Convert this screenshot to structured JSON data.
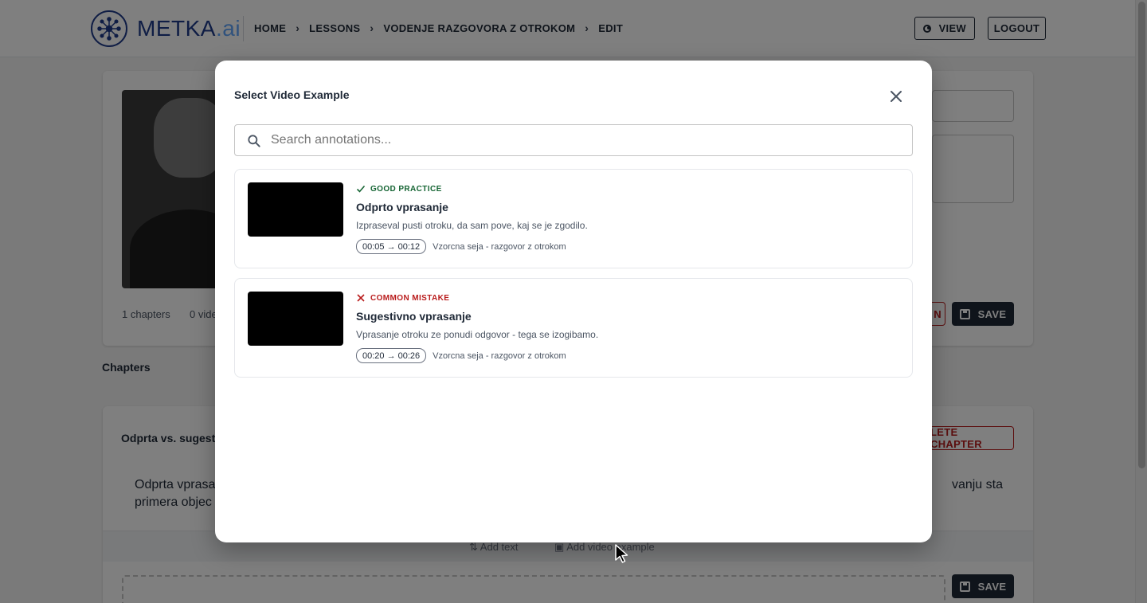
{
  "header": {
    "logo_main": "METKA",
    "logo_suffix": ".ai",
    "breadcrumb": [
      "HOME",
      "LESSONS",
      "VODENJE RAZGOVORA Z OTROKOM",
      "EDIT"
    ],
    "view_label": "VIEW",
    "logout_label": "LOGOUT"
  },
  "background": {
    "chapters_count": "1 chapters",
    "videos_count": "0 vide",
    "delete_partial": "N",
    "save_label": "SAVE",
    "section_label": "Chapters",
    "chapter_title": "Odprta vs. sugesti",
    "chapter_text_line1_left": "Odprta vprasa",
    "chapter_text_line1_right": "vanju sta",
    "chapter_text_line2_left": "primera objec",
    "delete_chapter_label": "LETE CHAPTER",
    "add_text_label": "Add text",
    "add_video_label": "Add video example",
    "save_label_2": "SAVE"
  },
  "modal": {
    "title": "Select Video Example",
    "search_placeholder": "Search annotations...",
    "items": [
      {
        "badge": "GOOD PRACTICE",
        "badge_icon": "check-icon",
        "title": "Odprto vprasanje",
        "description": "Izpraseval pusti otroku, da sam pove, kaj se je zgodilo.",
        "time": "00:05 → 00:12",
        "session": "Vzorcna seja - razgovor z otrokom"
      },
      {
        "badge": "COMMON MISTAKE",
        "badge_icon": "x-icon",
        "title": "Sugestivno vprasanje",
        "description": "Vprasanje otroku ze ponudi odgovor - tega se izogibamo.",
        "time": "00:20 → 00:26",
        "session": "Vzorcna seja - razgovor z otrokom"
      }
    ]
  },
  "colors": {
    "good": "#166534",
    "mistake": "#b91c1c",
    "primary_dark": "#1f2937",
    "brand": "#1e3a8a"
  }
}
